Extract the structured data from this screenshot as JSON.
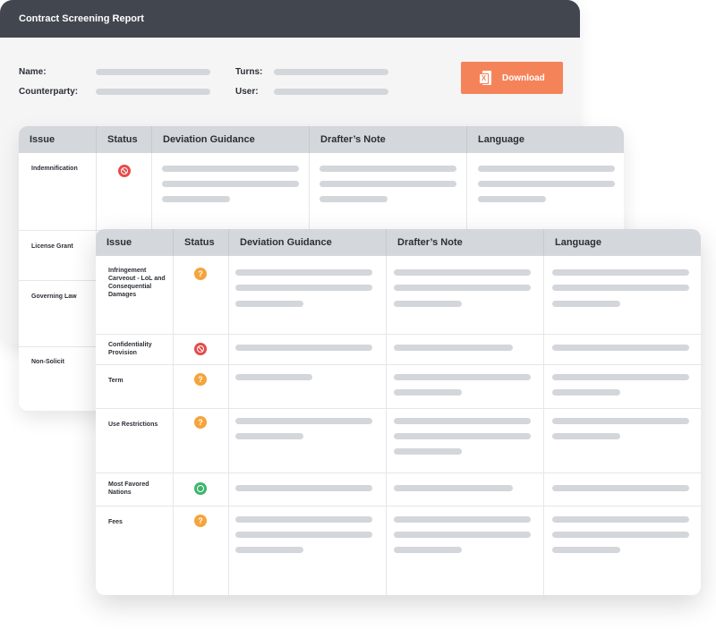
{
  "report": {
    "title": "Contract Screening Report",
    "meta": {
      "name_label": "Name:",
      "counterparty_label": "Counterparty:",
      "turns_label": "Turns:",
      "user_label": "User:"
    },
    "download_label": "Download",
    "accent_color": "#f5835a"
  },
  "columns": [
    "Issue",
    "Status",
    "Deviation Guidance",
    "Drafter’s Note",
    "Language"
  ],
  "back_rows": [
    {
      "issue": "Indemnification",
      "status": "blocked"
    },
    {
      "issue": "License Grant",
      "status": ""
    },
    {
      "issue": "Governing Law",
      "status": ""
    },
    {
      "issue": "Non-Solicit",
      "status": ""
    }
  ],
  "front_rows": [
    {
      "issue": "Infringement Carveout - LoL and Consequential Damages",
      "status": "question"
    },
    {
      "issue": "Confidentiality Provision",
      "status": "blocked"
    },
    {
      "issue": "Term",
      "status": "question"
    },
    {
      "issue": "Use Restrictions",
      "status": "question"
    },
    {
      "issue": "Most Favored Nations",
      "status": "ok"
    },
    {
      "issue": "Fees",
      "status": "question"
    }
  ],
  "status_glyphs": {
    "question": "?"
  },
  "status_colors": {
    "blocked": "#e64b4b",
    "question": "#f5a43b",
    "ok": "#3db46d"
  }
}
